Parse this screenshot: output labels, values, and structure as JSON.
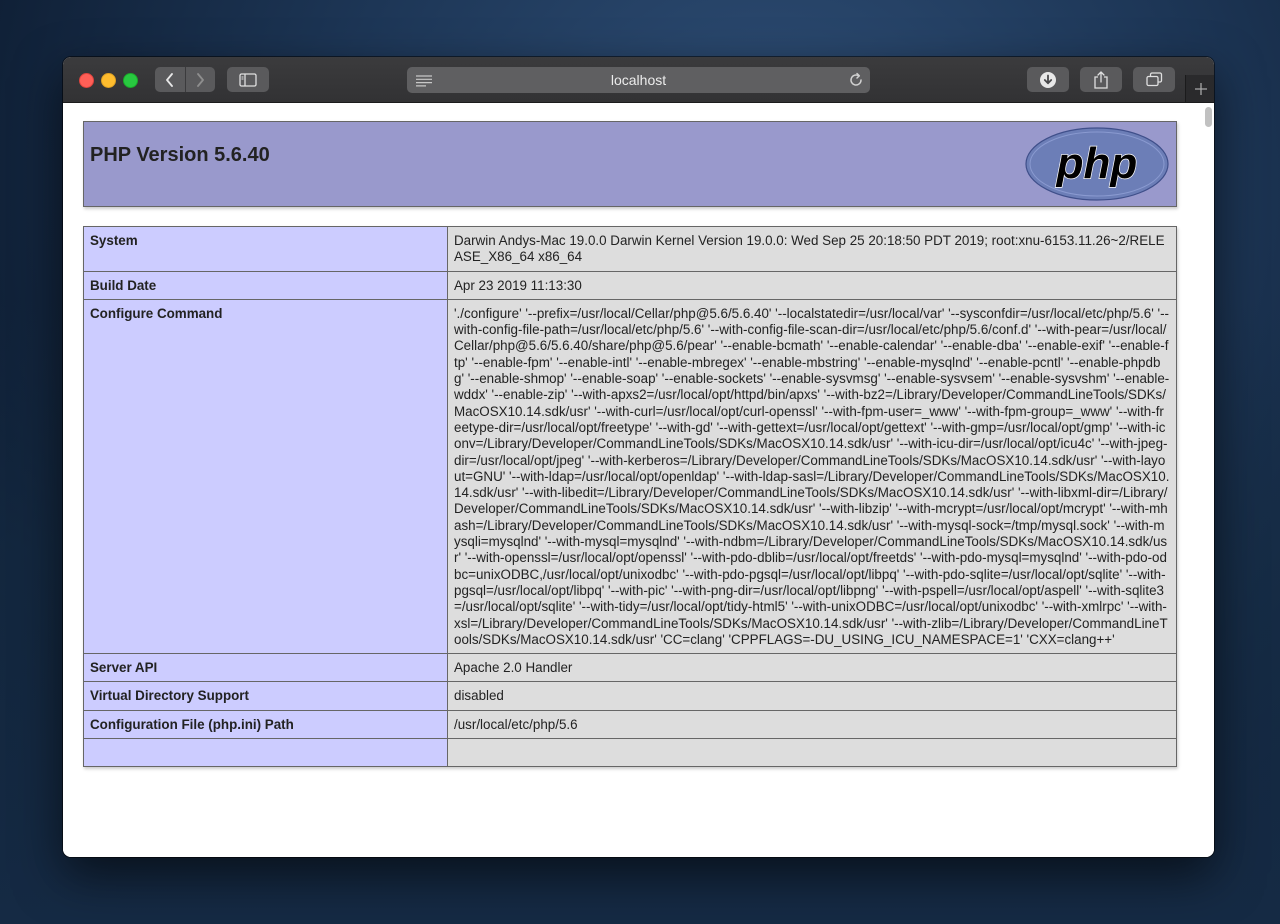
{
  "browser": {
    "url": "localhost"
  },
  "page": {
    "title": "PHP Version 5.6.40",
    "logo_text": "php"
  },
  "info_rows": [
    {
      "key": "System",
      "value": "Darwin Andys-Mac 19.0.0 Darwin Kernel Version 19.0.0: Wed Sep 25 20:18:50 PDT 2019; root:xnu-6153.11.26~2/RELEASE_X86_64 x86_64"
    },
    {
      "key": "Build Date",
      "value": "Apr 23 2019 11:13:30"
    },
    {
      "key": "Configure Command",
      "value": "'./configure' '--prefix=/usr/local/Cellar/php@5.6/5.6.40' '--localstatedir=/usr/local/var' '--sysconfdir=/usr/local/etc/php/5.6' '--with-config-file-path=/usr/local/etc/php/5.6' '--with-config-file-scan-dir=/usr/local/etc/php/5.6/conf.d' '--with-pear=/usr/local/Cellar/php@5.6/5.6.40/share/php@5.6/pear' '--enable-bcmath' '--enable-calendar' '--enable-dba' '--enable-exif' '--enable-ftp' '--enable-fpm' '--enable-intl' '--enable-mbregex' '--enable-mbstring' '--enable-mysqlnd' '--enable-pcntl' '--enable-phpdbg' '--enable-shmop' '--enable-soap' '--enable-sockets' '--enable-sysvmsg' '--enable-sysvsem' '--enable-sysvshm' '--enable-wddx' '--enable-zip' '--with-apxs2=/usr/local/opt/httpd/bin/apxs' '--with-bz2=/Library/Developer/CommandLineTools/SDKs/MacOSX10.14.sdk/usr' '--with-curl=/usr/local/opt/curl-openssl' '--with-fpm-user=_www' '--with-fpm-group=_www' '--with-freetype-dir=/usr/local/opt/freetype' '--with-gd' '--with-gettext=/usr/local/opt/gettext' '--with-gmp=/usr/local/opt/gmp' '--with-iconv=/Library/Developer/CommandLineTools/SDKs/MacOSX10.14.sdk/usr' '--with-icu-dir=/usr/local/opt/icu4c' '--with-jpeg-dir=/usr/local/opt/jpeg' '--with-kerberos=/Library/Developer/CommandLineTools/SDKs/MacOSX10.14.sdk/usr' '--with-layout=GNU' '--with-ldap=/usr/local/opt/openldap' '--with-ldap-sasl=/Library/Developer/CommandLineTools/SDKs/MacOSX10.14.sdk/usr' '--with-libedit=/Library/Developer/CommandLineTools/SDKs/MacOSX10.14.sdk/usr' '--with-libxml-dir=/Library/Developer/CommandLineTools/SDKs/MacOSX10.14.sdk/usr' '--with-libzip' '--with-mcrypt=/usr/local/opt/mcrypt' '--with-mhash=/Library/Developer/CommandLineTools/SDKs/MacOSX10.14.sdk/usr' '--with-mysql-sock=/tmp/mysql.sock' '--with-mysqli=mysqlnd' '--with-mysql=mysqlnd' '--with-ndbm=/Library/Developer/CommandLineTools/SDKs/MacOSX10.14.sdk/usr' '--with-openssl=/usr/local/opt/openssl' '--with-pdo-dblib=/usr/local/opt/freetds' '--with-pdo-mysql=mysqlnd' '--with-pdo-odbc=unixODBC,/usr/local/opt/unixodbc' '--with-pdo-pgsql=/usr/local/opt/libpq' '--with-pdo-sqlite=/usr/local/opt/sqlite' '--with-pgsql=/usr/local/opt/libpq' '--with-pic' '--with-png-dir=/usr/local/opt/libpng' '--with-pspell=/usr/local/opt/aspell' '--with-sqlite3=/usr/local/opt/sqlite' '--with-tidy=/usr/local/opt/tidy-html5' '--with-unixODBC=/usr/local/opt/unixodbc' '--with-xmlrpc' '--with-xsl=/Library/Developer/CommandLineTools/SDKs/MacOSX10.14.sdk/usr' '--with-zlib=/Library/Developer/CommandLineTools/SDKs/MacOSX10.14.sdk/usr' 'CC=clang' 'CPPFLAGS=-DU_USING_ICU_NAMESPACE=1' 'CXX=clang++'"
    },
    {
      "key": "Server API",
      "value": "Apache 2.0 Handler"
    },
    {
      "key": "Virtual Directory Support",
      "value": "disabled"
    },
    {
      "key": "Configuration File (php.ini) Path",
      "value": "/usr/local/etc/php/5.6"
    },
    {
      "key": "",
      "value": ""
    }
  ],
  "colors": {
    "header_bg": "#9999cc",
    "key_cell_bg": "#ccccff",
    "value_cell_bg": "#dddddd",
    "logo_bg": "#6c7eb7"
  }
}
